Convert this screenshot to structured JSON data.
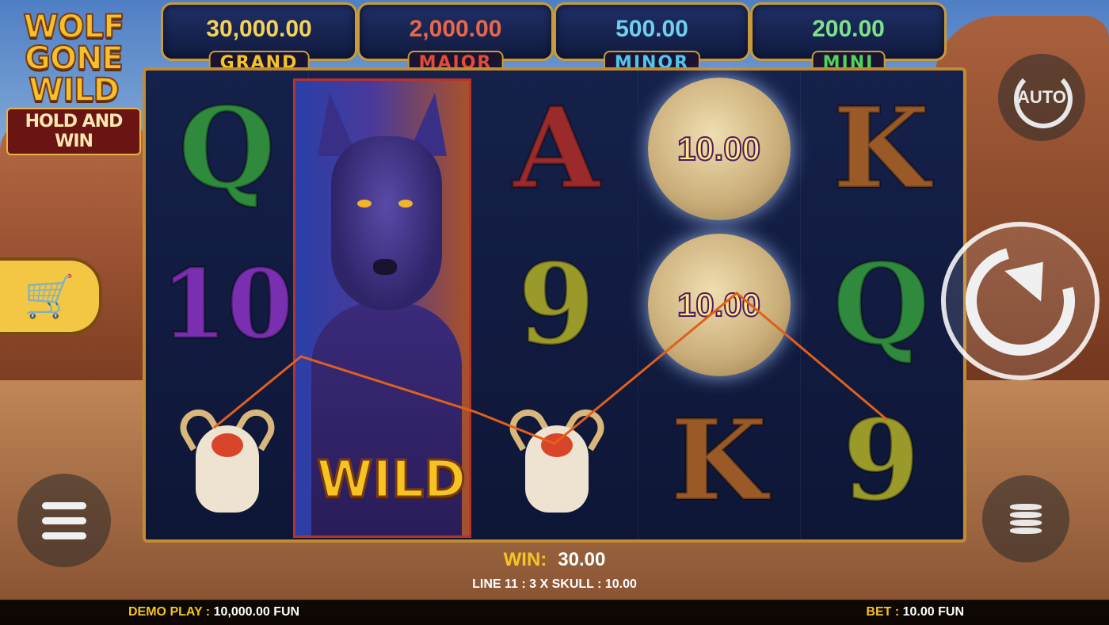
{
  "game": {
    "logo_line1": "WOLF",
    "logo_line2": "GONE",
    "logo_line3": "WILD",
    "logo_sub": "HOLD AND WIN"
  },
  "jackpots": [
    {
      "label": "GRAND",
      "value": "30,000.00",
      "value_color": "#f5d257",
      "label_color": "#f5c423"
    },
    {
      "label": "MAJOR",
      "value": "2,000.00",
      "value_color": "#e8674a",
      "label_color": "#e64a33"
    },
    {
      "label": "MINOR",
      "value": "500.00",
      "value_color": "#6fd0ee",
      "label_color": "#4fc6ef"
    },
    {
      "label": "MINI",
      "value": "200.00",
      "value_color": "#7fe08a",
      "label_color": "#4fd65a"
    }
  ],
  "reels": [
    [
      "Q",
      "10",
      "skull"
    ],
    [
      "wolf",
      "wolf",
      "wolf"
    ],
    [
      "A",
      "9",
      "skull"
    ],
    [
      "10.00",
      "10.00",
      "K"
    ],
    [
      "K",
      "Q",
      "9"
    ]
  ],
  "wild_label": "WILD",
  "buttons": {
    "auto": "AUTO",
    "spin_icon": "spin-arrow-icon",
    "menu_icon": "hamburger-icon",
    "coins_icon": "coins-stack-icon",
    "shop_icon": "shopping-cart-icon"
  },
  "win": {
    "label": "WIN:",
    "amount": "30.00",
    "line_text": "LINE 11 : 3 X SKULL : 10.00"
  },
  "footer": {
    "demo_label": "DEMO PLAY :",
    "demo_value": "10,000.00 FUN",
    "bet_label": "BET :",
    "bet_value": "10.00 FUN"
  }
}
